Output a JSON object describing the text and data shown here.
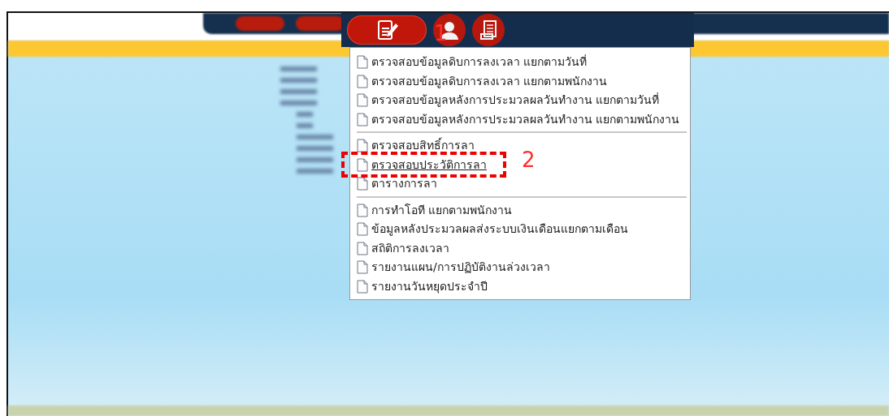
{
  "toolbar": {
    "buttons": [
      {
        "kind": "edit",
        "selected": true
      },
      {
        "kind": "user",
        "selected": false
      },
      {
        "kind": "report",
        "selected": false
      }
    ]
  },
  "menu": {
    "groups": [
      {
        "items": [
          {
            "label": "ตรวจสอบข้อมูลดิบการลงเวลา แยกตามวันที่",
            "selected": false
          },
          {
            "label": "ตรวจสอบข้อมูลดิบการลงเวลา แยกตามพนักงาน",
            "selected": false
          },
          {
            "label": "ตรวจสอบข้อมูลหลังการประมวลผลวันทำงาน แยกตามวันที่",
            "selected": false
          },
          {
            "label": "ตรวจสอบข้อมูลหลังการประมวลผลวันทำงาน แยกตามพนักงาน",
            "selected": false
          }
        ]
      },
      {
        "items": [
          {
            "label": "ตรวจสอบสิทธิ์การลา",
            "selected": false
          },
          {
            "label": "ตรวจสอบประวัติการลา",
            "selected": true
          },
          {
            "label": "ตารางการลา",
            "selected": false
          }
        ]
      },
      {
        "items": [
          {
            "label": "การทำโอที แยกตามพนักงาน",
            "selected": false
          },
          {
            "label": "ข้อมูลหลังประมวลผลส่งระบบเงินเดือนแยกตามเดือน",
            "selected": false
          },
          {
            "label": "สถิติการลงเวลา",
            "selected": false
          },
          {
            "label": "รายงานแผน/การปฏิบัติงานล่วงเวลา",
            "selected": false
          },
          {
            "label": "รายงานวันหยุดประจำปี",
            "selected": false
          }
        ]
      }
    ]
  },
  "annotations": [
    {
      "label": "1",
      "kind": "step"
    },
    {
      "label": "2",
      "kind": "step"
    }
  ]
}
